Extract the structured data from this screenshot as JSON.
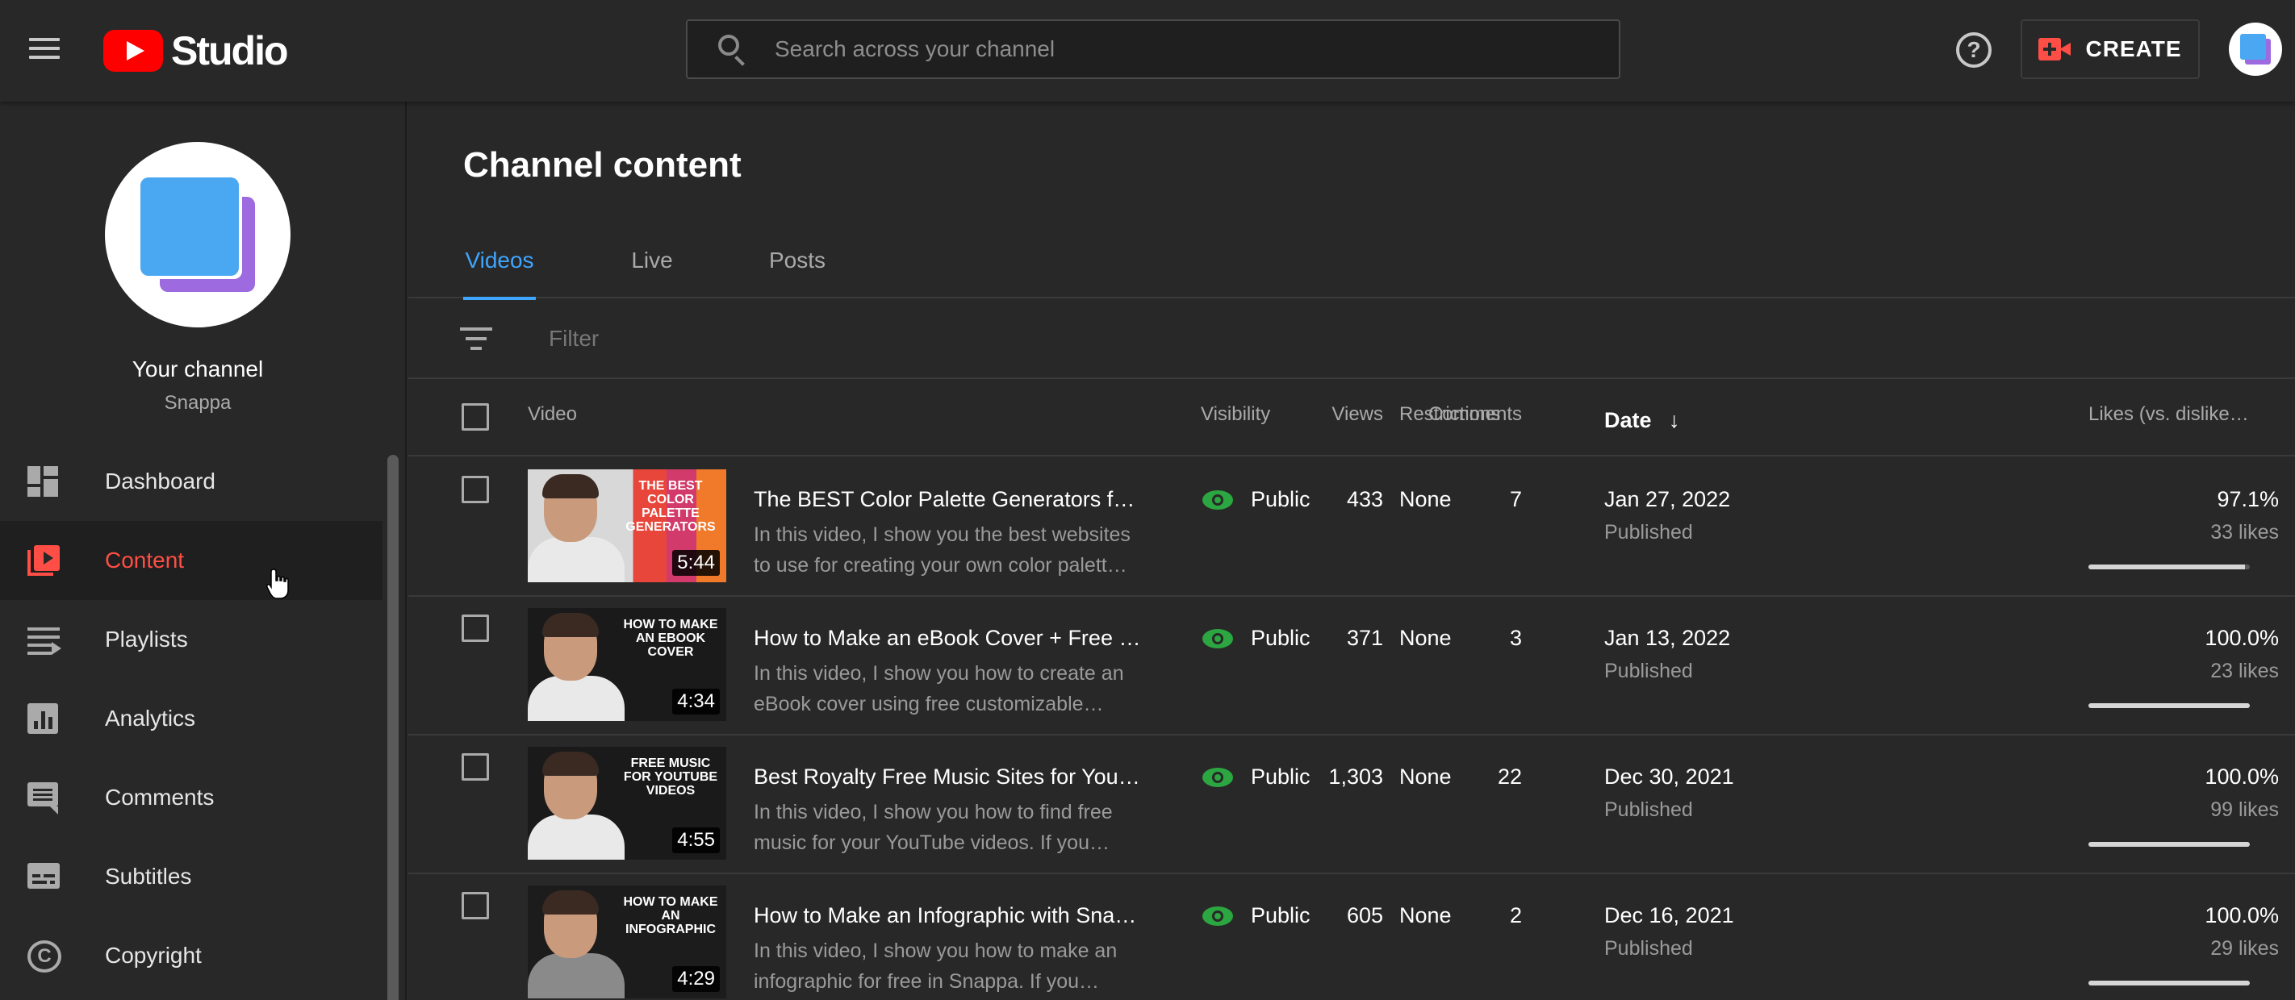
{
  "app": {
    "logo_text": "Studio"
  },
  "search": {
    "placeholder": "Search across your channel"
  },
  "header": {
    "create_label": "CREATE",
    "help_glyph": "?"
  },
  "sidebar": {
    "your_channel": "Your channel",
    "channel_name": "Snappa",
    "items": [
      {
        "label": "Dashboard",
        "icon": "dashboard-icon"
      },
      {
        "label": "Content",
        "icon": "content-icon",
        "active": true
      },
      {
        "label": "Playlists",
        "icon": "playlists-icon"
      },
      {
        "label": "Analytics",
        "icon": "analytics-icon"
      },
      {
        "label": "Comments",
        "icon": "comments-icon"
      },
      {
        "label": "Subtitles",
        "icon": "subtitles-icon"
      },
      {
        "label": "Copyright",
        "icon": "copyright-icon",
        "glyph": "C"
      }
    ]
  },
  "main": {
    "title": "Channel content",
    "tabs": [
      {
        "label": "Videos",
        "active": true
      },
      {
        "label": "Live"
      },
      {
        "label": "Posts"
      }
    ],
    "filter_placeholder": "Filter",
    "columns": {
      "video": "Video",
      "visibility": "Visibility",
      "restrictions": "Restrictions",
      "date": "Date",
      "views": "Views",
      "comments": "Comments",
      "likes": "Likes (vs. dislike…"
    }
  },
  "videos": [
    {
      "title": "The BEST Color Palette Generators for…",
      "desc1": "In this video, I show you the best websites",
      "desc2": "to use for creating your own color palett…",
      "thumb_text": "The Best Color Palette Generators",
      "duration": "5:44",
      "visibility": "Public",
      "restrictions": "None",
      "date": "Jan 27, 2022",
      "status": "Published",
      "views": "433",
      "comments": "7",
      "likes_pct": "97.1%",
      "likes_count": "33 likes",
      "likes_ratio": 0.971
    },
    {
      "title": "How to Make an eBook Cover + Free C…",
      "desc1": "In this video, I show you how to create an",
      "desc2": "eBook cover using free customizable…",
      "thumb_text": "How to Make an eBook Cover",
      "duration": "4:34",
      "visibility": "Public",
      "restrictions": "None",
      "date": "Jan 13, 2022",
      "status": "Published",
      "views": "371",
      "comments": "3",
      "likes_pct": "100.0%",
      "likes_count": "23 likes",
      "likes_ratio": 1.0
    },
    {
      "title": "Best Royalty Free Music Sites for YouT…",
      "desc1": "In this video, I show you how to find free",
      "desc2": "music for your YouTube videos. If you…",
      "thumb_text": "Free Music for YouTube Videos",
      "duration": "4:55",
      "visibility": "Public",
      "restrictions": "None",
      "date": "Dec 30, 2021",
      "status": "Published",
      "views": "1,303",
      "comments": "22",
      "likes_pct": "100.0%",
      "likes_count": "99 likes",
      "likes_ratio": 1.0
    },
    {
      "title": "How to Make an Infographic with Sna…",
      "desc1": "In this video, I show you how to make an",
      "desc2": "infographic for free in Snappa. If you…",
      "thumb_text": "How to Make an Infographic",
      "duration": "4:29",
      "visibility": "Public",
      "restrictions": "None",
      "date": "Dec 16, 2021",
      "status": "Published",
      "views": "605",
      "comments": "2",
      "likes_pct": "100.0%",
      "likes_count": "29 likes",
      "likes_ratio": 1.0
    }
  ],
  "colors": {
    "accent": "#3ea6ff",
    "brand_red": "#ff0000",
    "active_nav": "#ff4e45",
    "public_green": "#2ba640"
  }
}
